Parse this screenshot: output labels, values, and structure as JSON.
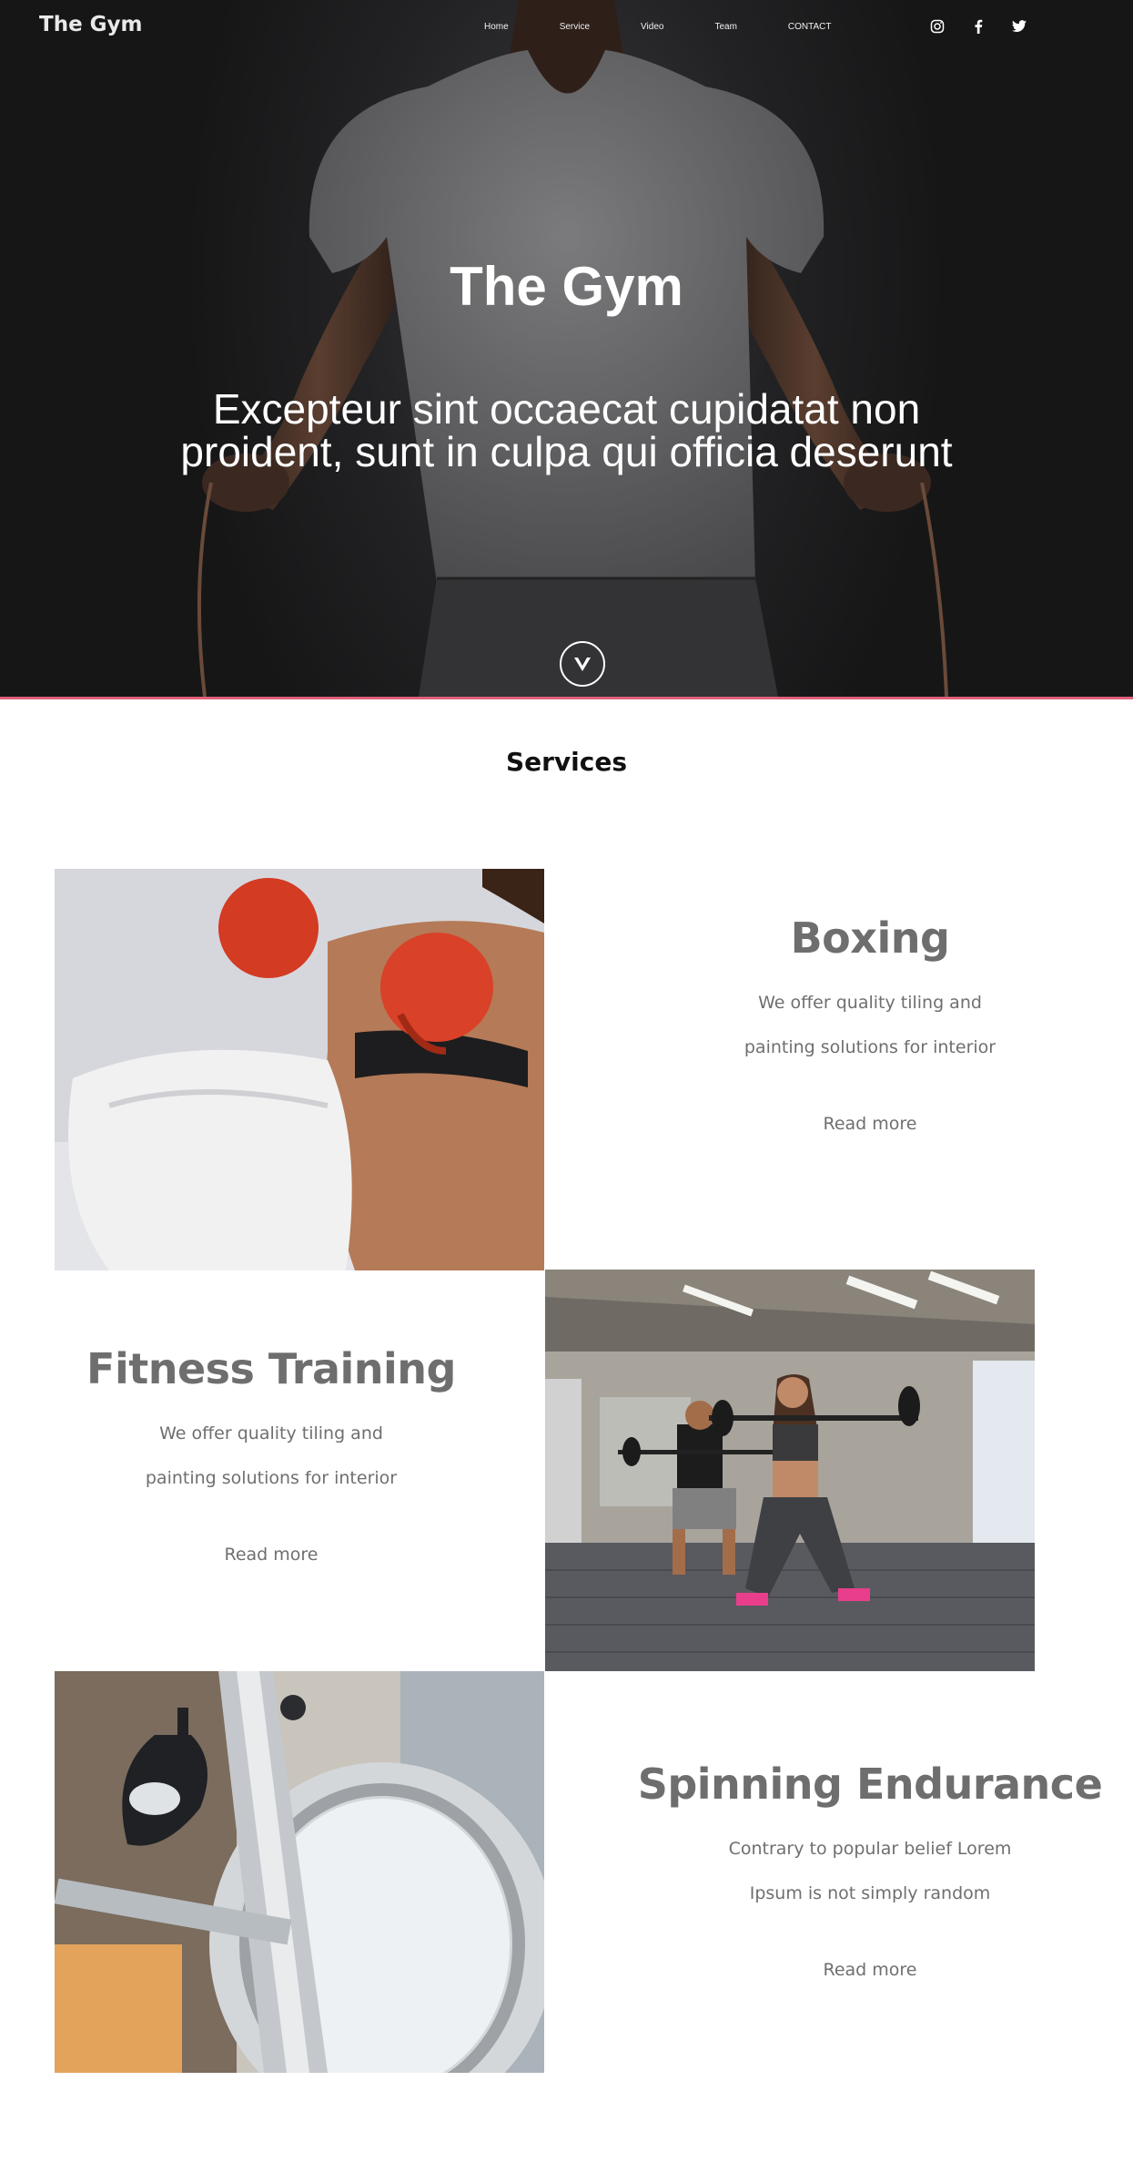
{
  "nav": {
    "brand": "The Gym",
    "links": [
      "Home",
      "Service",
      "Video",
      "Team",
      "CONTACT"
    ],
    "social_icons": [
      "instagram-icon",
      "facebook-icon",
      "twitter-icon"
    ]
  },
  "hero": {
    "title": "The Gym",
    "subtitle": "Excepteur sint occaecat cupidatat non proident, sunt in culpa qui officia deserunt",
    "scroll_icon": "chevron-down-icon"
  },
  "services": {
    "heading": "Services",
    "items": [
      {
        "name": "Boxing",
        "description": "We offer quality tiling and painting solutions for interior",
        "more": "Read more"
      },
      {
        "name": "Fitness Training",
        "description": "We offer quality tiling and painting solutions for interior",
        "more": "Read more"
      },
      {
        "name": "Spinning Endurance",
        "description": "Contrary to popular belief Lorem Ipsum is not simply random",
        "more": "Read more"
      }
    ]
  },
  "colors": {
    "hero_accent_line": "#e0607a",
    "service_heading": "#6e6e6e",
    "text_gray": "#6f6f6f"
  }
}
